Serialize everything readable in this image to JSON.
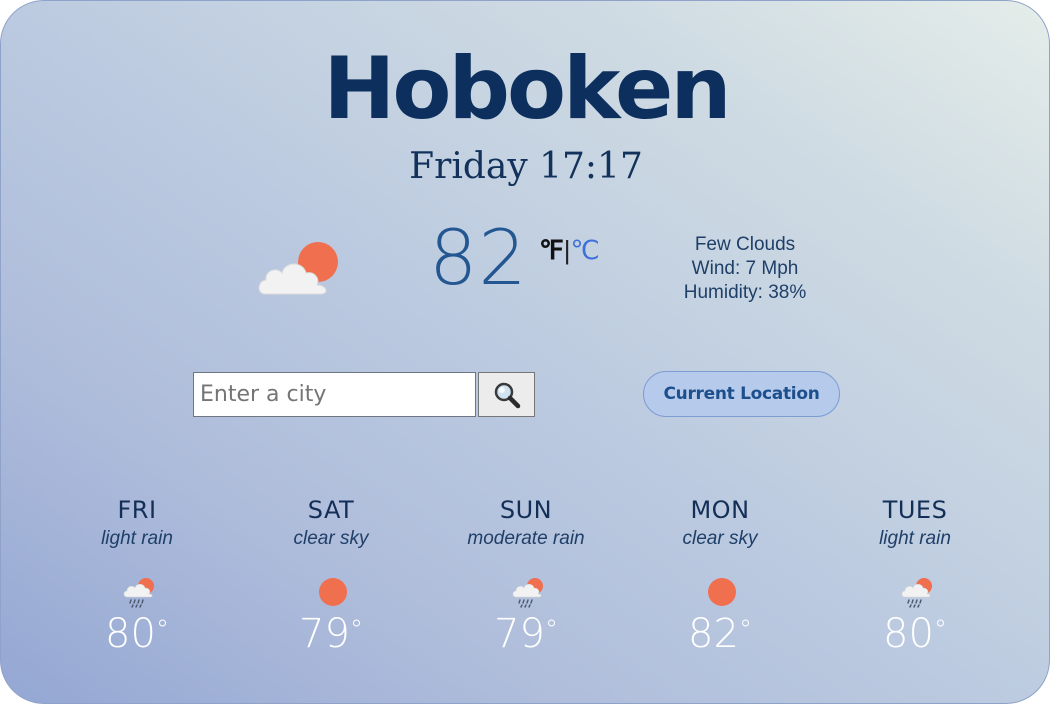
{
  "city": "Hoboken",
  "datetime": "Friday 17:17",
  "current": {
    "temperature": "82",
    "unit_f": "℉",
    "unit_separator": "|",
    "unit_c": "℃",
    "icon": "few-clouds-icon",
    "description": "Few Clouds",
    "wind": "Wind: 7 Mph",
    "humidity": "Humidity: 38%"
  },
  "search": {
    "placeholder": "Enter a city",
    "button_icon": "search-icon"
  },
  "location_button": "Current Location",
  "forecast": [
    {
      "day": "FRI",
      "description": "light rain",
      "temp": "80",
      "degree": "°",
      "icon": "rain-icon"
    },
    {
      "day": "SAT",
      "description": "clear sky",
      "temp": "79",
      "degree": "°",
      "icon": "sun-icon"
    },
    {
      "day": "SUN",
      "description": "moderate rain",
      "temp": "79",
      "degree": "°",
      "icon": "rain-icon"
    },
    {
      "day": "MON",
      "description": "clear sky",
      "temp": "82",
      "degree": "°",
      "icon": "sun-icon"
    },
    {
      "day": "TUES",
      "description": "light rain",
      "temp": "80",
      "degree": "°",
      "icon": "rain-icon"
    }
  ],
  "colors": {
    "title": "#0d2f5e",
    "temperature": "#245791",
    "button_bg": "#b6cbec",
    "sun": "#ef6f4e",
    "forecast_temp": "#ffffff"
  }
}
